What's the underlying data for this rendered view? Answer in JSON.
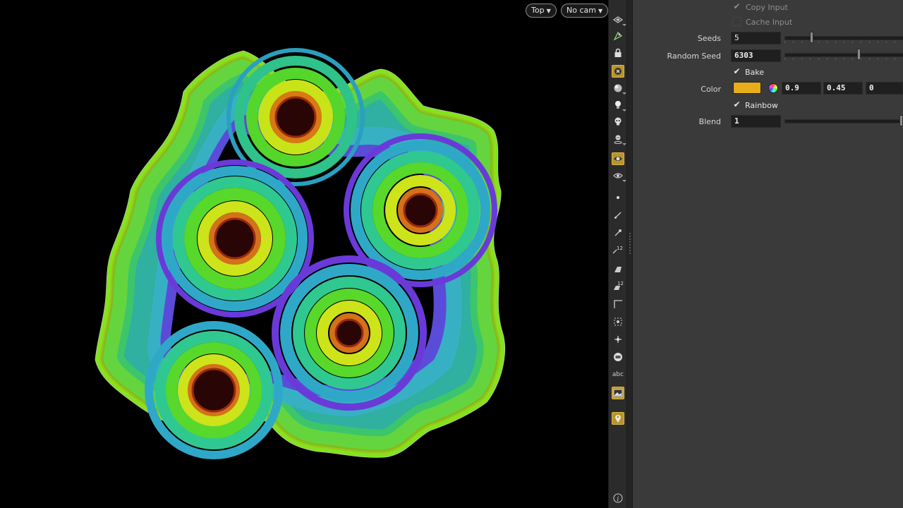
{
  "viewport": {
    "view_menu": "Top",
    "camera_menu": "No cam"
  },
  "toolbar": {
    "icons": [
      "display-options-icon",
      "ghost-icon",
      "lock-icon",
      "close-view-icon",
      "shading-icon",
      "light-icon",
      "skull-icon",
      "person-icon",
      "render-icon",
      "eye-icon",
      "point-icon",
      "wire-icon",
      "pin-icon",
      "numbers-icon",
      "brush-icon",
      "numbers-brush-icon",
      "corner-icon",
      "snap-icon",
      "tangent-icon",
      "bounds-icon",
      "text-icon",
      "background-icon",
      "info-icon"
    ],
    "text_tool_label": "abc",
    "number_badge": "12"
  },
  "params": {
    "copy_input": {
      "label": "Copy Input",
      "checked": true,
      "enabled": false
    },
    "cache_input": {
      "label": "Cache Input",
      "checked": false,
      "enabled": false
    },
    "seeds": {
      "label": "Seeds",
      "value": "5",
      "slider": 0.22
    },
    "random_seed": {
      "label": "Random Seed",
      "value": "6303",
      "slider": 0.63
    },
    "bake": {
      "label": "Bake",
      "checked": true
    },
    "color": {
      "label": "Color",
      "swatch": "#e8ad1a",
      "r": "0.9",
      "g": "0.45",
      "b": "0"
    },
    "rainbow": {
      "label": "Rainbow",
      "checked": true
    },
    "blend": {
      "label": "Blend",
      "value": "1",
      "slider": 1.0
    }
  },
  "colors": {
    "accent_tool": "#b8952a",
    "panel_bg": "#3a3a3a"
  }
}
